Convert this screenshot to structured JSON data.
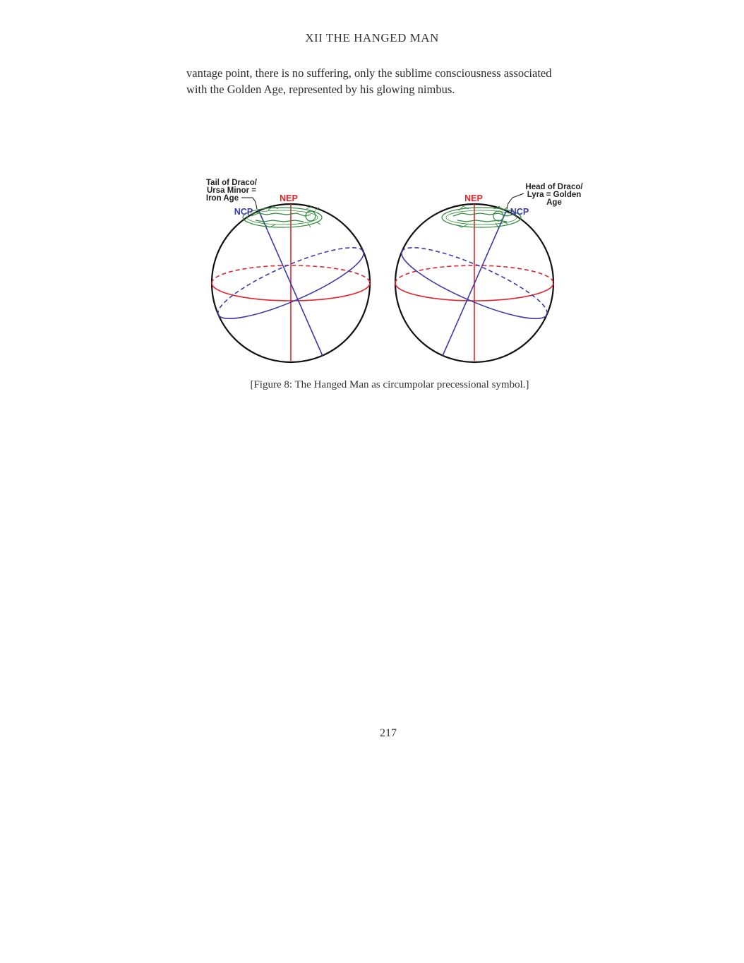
{
  "header": {
    "running_title": "XII THE HANGED MAN"
  },
  "body": {
    "paragraph_line_1": "vantage point, there is no suffering, only the sublime consciousness associated",
    "paragraph_line_2": "with the Golden Age, represented by his glowing nimbus."
  },
  "figure": {
    "left_globe": {
      "annotation_lines": [
        "Tail of Draco/",
        "Ursa Minor =",
        "Iron Age"
      ],
      "nep_label": "NEP",
      "ncp_label": "NCP"
    },
    "right_globe": {
      "annotation_lines": [
        "Head of Draco/",
        "Lyra = Golden",
        "Age"
      ],
      "nep_label": "NEP",
      "ncp_label": "NCP"
    },
    "colors": {
      "ecliptic": "#e0242b",
      "equator": "#3a3aa8",
      "figure": "#2e8a3a",
      "outline": "#111111"
    },
    "caption": "[Figure 8: The Hanged Man as circumpolar precessional symbol.]"
  },
  "footer": {
    "page_number": "217"
  }
}
